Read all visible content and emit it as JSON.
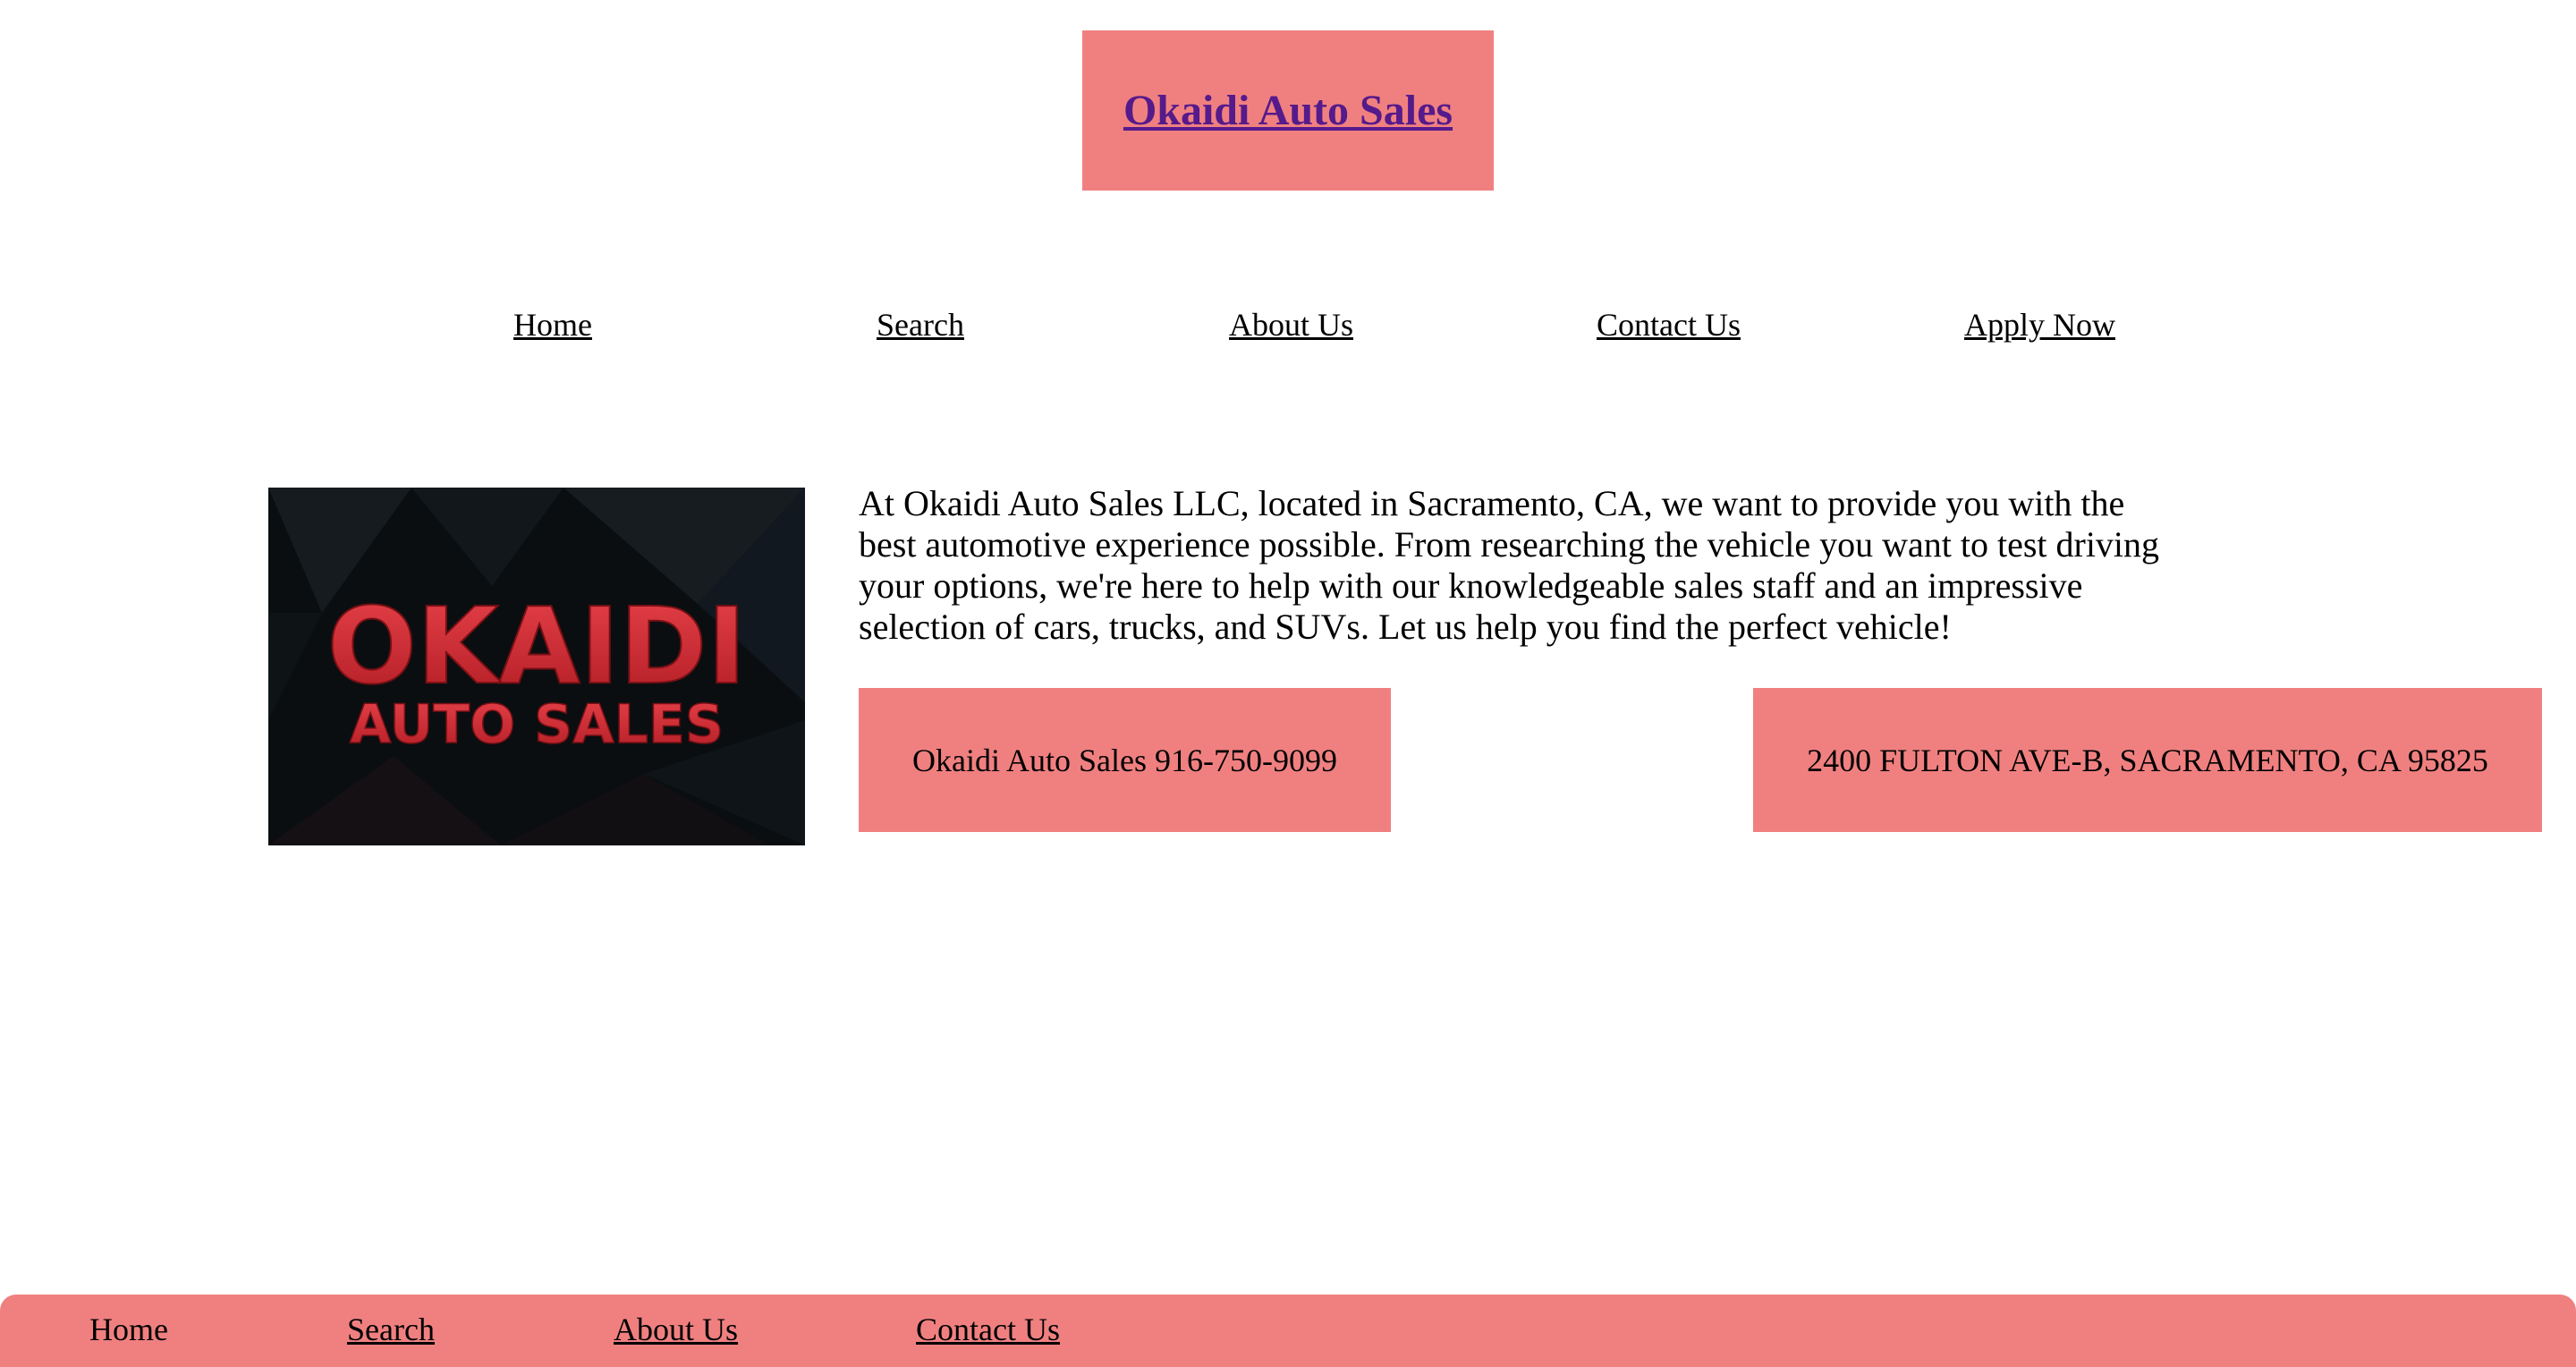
{
  "header": {
    "title": "Okaidi Auto Sales"
  },
  "nav": {
    "items": [
      "Home",
      "Search",
      "About Us",
      "Contact Us",
      "Apply Now"
    ]
  },
  "logo": {
    "line1": "OKAIDI",
    "line2": "AUTO SALES"
  },
  "intro": {
    "text": "At Okaidi Auto Sales LLC, located in Sacramento, CA, we want to provide you with the best automotive experience possible. From researching the vehicle you want to test driving your options, we're here to help with our knowledgeable sales staff and an impressive selection of cars, trucks, and SUVs. Let us help you find the perfect vehicle!"
  },
  "contact": {
    "phone": "Okaidi Auto Sales 916-750-9099",
    "address": "2400 FULTON AVE-B, SACRAMENTO, CA 95825"
  },
  "footer": {
    "items": [
      "Home",
      "Search",
      "About Us",
      "Contact Us"
    ]
  },
  "colors": {
    "accent": "#f08080",
    "visited_link": "#551a8b",
    "logo_red": "#d42a33",
    "logo_bg": "#0b0e10"
  }
}
